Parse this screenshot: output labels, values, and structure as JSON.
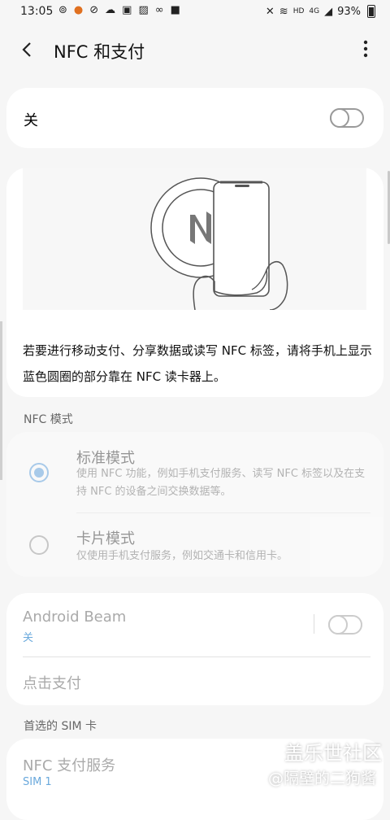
{
  "status_bar": {
    "time": "13:05",
    "left_icons": [
      "weibo-icon",
      "notification-badge-icon",
      "sync-icon",
      "cloud-icon",
      "lock-icon",
      "gallery-icon",
      "link-icon",
      "video-icon"
    ],
    "network": "HD",
    "signal": "4G",
    "battery": "93%"
  },
  "app_bar": {
    "title": "NFC 和支付"
  },
  "master": {
    "label": "关",
    "enabled": false
  },
  "illustration": {
    "description": "若要进行移动支付、分享数据或读写 NFC 标签，请将手机上显示蓝色圆圈的部分靠在 NFC 读卡器上。"
  },
  "nfc_mode": {
    "header": "NFC 模式",
    "options": [
      {
        "title": "标准模式",
        "desc": "使用 NFC 功能，例如手机支付服务、读写 NFC 标签以及在支持 NFC 的设备之间交换数据等。",
        "selected": true
      },
      {
        "title": "卡片模式",
        "desc": "仅使用手机支付服务，例如交通卡和信用卡。",
        "selected": false
      }
    ]
  },
  "android_beam": {
    "title": "Android Beam",
    "status": "关",
    "enabled": false
  },
  "tap_pay": {
    "label": "点击支付"
  },
  "sim": {
    "header": "首选的 SIM 卡",
    "title": "NFC 支付服务",
    "value": "SIM 1"
  },
  "watermark": {
    "logo": "盖乐世社区",
    "user": "@隔壁的二狗酱"
  },
  "colors": {
    "accent": "#3e8ed8",
    "sub_text": "#6aa9dc",
    "background": "#f6f6f6"
  }
}
